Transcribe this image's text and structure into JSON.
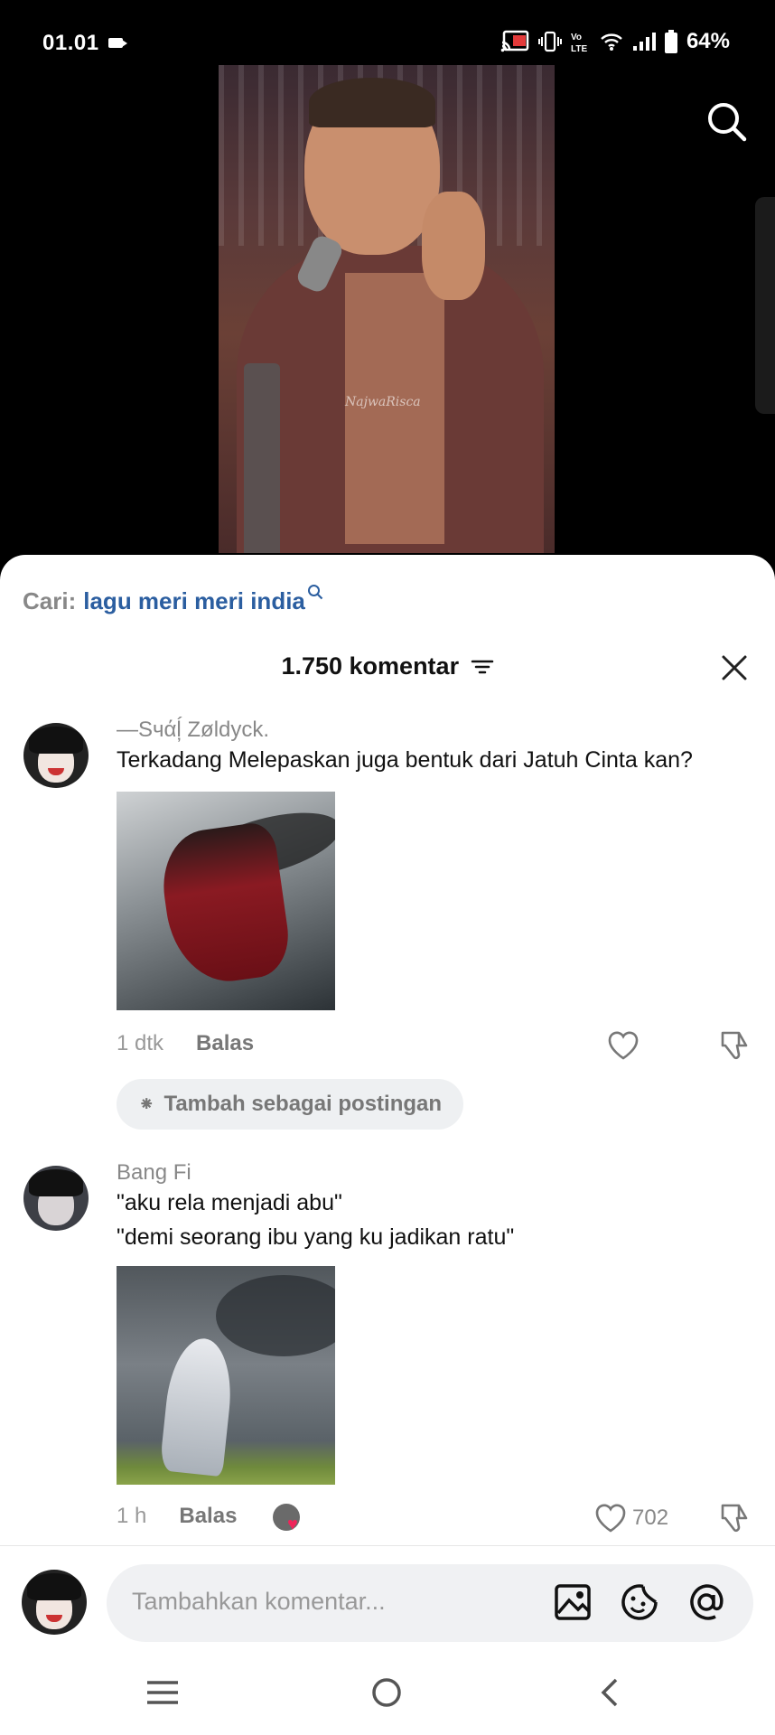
{
  "status_bar": {
    "time": "01.01",
    "battery": "64%"
  },
  "video": {
    "watermark": "NajwaRisca"
  },
  "related_search": {
    "label": "Cari:",
    "query": "lagu meri meri india"
  },
  "comments_header": {
    "count": "1.750 komentar"
  },
  "comments": [
    {
      "username": "—Sчάĺ̦ Zøldyck.",
      "text_lines": [
        "Terkadang Melepaskan juga bentuk dari Jatuh Cinta kan?"
      ],
      "time": "1 dtk",
      "reply_label": "Balas",
      "add_post_label": "Tambah sebagai postingan"
    },
    {
      "username": "Bang Fi",
      "text_lines": [
        "\"aku rela menjadi abu\"",
        "\"demi seorang ibu yang ku jadikan ratu\""
      ],
      "time": "1 h",
      "reply_label": "Balas",
      "likes": "702"
    }
  ],
  "input": {
    "placeholder": "Tambahkan komentar..."
  },
  "icons": {
    "search": "search-icon",
    "filter": "filter-icon",
    "close": "close-icon",
    "heart": "heart-icon",
    "dislike": "dislike-icon",
    "image": "image-icon",
    "emoji": "emoji-icon",
    "mention": "at-icon",
    "menu": "menu-icon",
    "home": "home-icon",
    "back": "back-icon"
  },
  "colors": {
    "link": "#2b5ea0",
    "sheet": "#ffffff",
    "like_heart": "#f0245a"
  }
}
